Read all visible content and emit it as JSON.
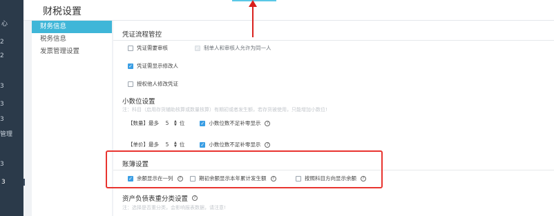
{
  "navbar": {
    "items": [
      {
        "label": "心"
      },
      {
        "label": "2"
      },
      {
        "label": "2"
      },
      {
        "label": "3"
      },
      {
        "label": "3"
      },
      {
        "label": "3"
      },
      {
        "label": "管理"
      },
      {
        "label": "3"
      },
      {
        "label": "3"
      }
    ]
  },
  "page": {
    "title": "财税设置"
  },
  "subnav": {
    "items": [
      {
        "label": "财务信息",
        "active": true
      },
      {
        "label": "税务信息",
        "active": false
      },
      {
        "label": "发票管理设置",
        "active": false
      }
    ]
  },
  "voucher_control": {
    "title": "凭证流程管控",
    "need_audit": {
      "label": "凭证需要审核",
      "checked": false
    },
    "same_person": {
      "label": "制单人和审核人允许为同一人",
      "checked": true,
      "disabled": true
    },
    "show_modifier": {
      "label": "凭证需显示修改人",
      "checked": true
    },
    "authorize_modify": {
      "label": "授权他人修改凭证",
      "checked": false
    }
  },
  "decimal_settings": {
    "title": "小数位设置",
    "note": "注：科目（启用存货辅助核算或数量核算）有期初或者发生额，若存货被使用，只能增加小数位!",
    "quantity": {
      "prefix": "【数量】最多",
      "value": "5",
      "suffix": "位",
      "pad_label": "小数位数不足补零显示",
      "pad_checked": true
    },
    "price": {
      "prefix": "【单价】最多",
      "value": "5",
      "suffix": "位",
      "pad_label": "小数位数不足补零显示",
      "pad_checked": true
    }
  },
  "ledger_settings": {
    "title": "账簿设置",
    "balance_one_column": {
      "label": "余额显示在一列",
      "checked": true
    },
    "opening_balance": {
      "label": "期初余额显示本年累计发生额",
      "checked": false
    },
    "direction_balance": {
      "label": "按照科目方向显示余额",
      "checked": false
    }
  },
  "balance_sheet": {
    "title": "资产负债表重分类设置",
    "note": "注：选择是否重分类，会影响报表数据，请注意!"
  },
  "icons": {
    "help": "?",
    "check": "✓",
    "up": "▲",
    "down": "▼"
  },
  "colors": {
    "accent": "#3fb6d8",
    "checkbox": "#3a9ee4",
    "highlight": "#e8332e"
  }
}
